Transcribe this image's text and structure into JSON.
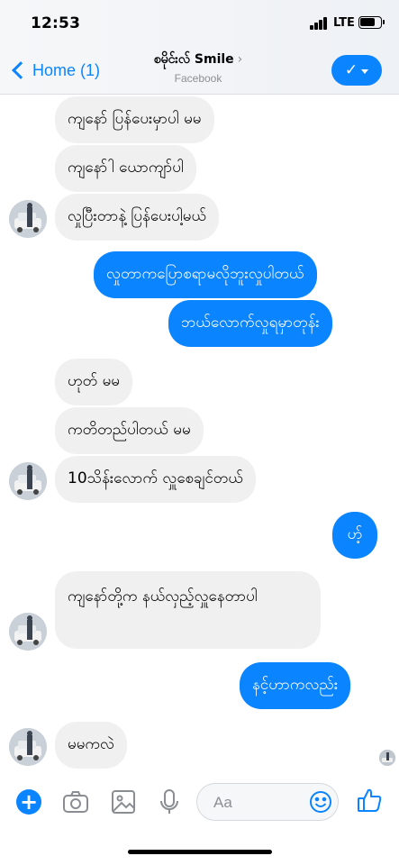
{
  "status_bar": {
    "time": "12:53",
    "network": "LTE"
  },
  "header": {
    "back_label": "Home (1)",
    "contact_name": "စမိုင်းလ် Smile",
    "contact_sub": "Facebook",
    "chevron": "›",
    "action_check": "✓"
  },
  "messages": [
    {
      "from": "in",
      "text": "ကျနော် ပြန်ပေးမှာပါ မမ"
    },
    {
      "from": "in",
      "text": "ကျနော်ါ ယောကျာ်ပါ"
    },
    {
      "from": "in",
      "text": "လှုပြီးတာနဲ့ ပြန်ပေးပါ့မယ်"
    },
    {
      "from": "out",
      "text": "လှုတာကပြောစရာမလိုဘူးလှုပါတယ်"
    },
    {
      "from": "out",
      "text": "ဘယ်လောက်လှုရမှာတုန်း"
    },
    {
      "from": "in",
      "text": "ဟုတ် မမ"
    },
    {
      "from": "in",
      "text": "ကတိတည်ပါတယ် မမ"
    },
    {
      "from": "in",
      "text": "10သိန်းလောက် လှူစေချင်တယ်"
    },
    {
      "from": "out",
      "text": "ဟ့်"
    },
    {
      "from": "in",
      "text": "ကျနော်တို့က နယ်လှည့်လှူနေတာပါ"
    },
    {
      "from": "out",
      "text": "နင့်ဟာကလည်း"
    },
    {
      "from": "in",
      "text": "မမကလဲ"
    }
  ],
  "composer": {
    "placeholder": "Aa"
  },
  "icons": {
    "back": "chevron-left-icon",
    "action": "checkmark-icon",
    "plus": "plus-icon",
    "camera": "camera-icon",
    "gallery": "image-icon",
    "mic": "microphone-icon",
    "emoji": "smiley-icon",
    "like": "thumbs-up-icon"
  },
  "colors": {
    "accent": "#0b84ff",
    "incoming_bubble": "#f1f0f0",
    "outgoing_text": "#ffffff"
  }
}
